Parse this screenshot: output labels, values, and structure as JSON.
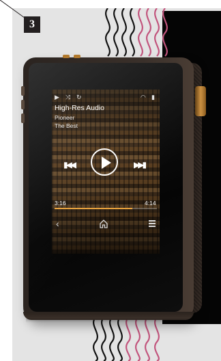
{
  "badge": {
    "number": "3"
  },
  "player": {
    "status_icons": {
      "play": "play-icon",
      "shuffle": "shuffle-icon",
      "repeat": "repeat-icon",
      "wifi": "wifi-icon",
      "battery": "battery-icon"
    },
    "track": {
      "title": "High-Res Audio",
      "artist": "Pioneer",
      "album": "The Best"
    },
    "controls": {
      "prev": "previous-icon",
      "play": "play-icon",
      "next": "next-icon"
    },
    "time": {
      "elapsed": "3:16",
      "total": "4:14"
    },
    "progress": 0.76,
    "nav": {
      "back": "back-icon",
      "home": "home-icon",
      "menu": "menu-icon"
    }
  },
  "colors": {
    "accent": "#e8a23c",
    "wave_pink": "#c2557d",
    "wave_black": "#111111",
    "device_body": "#2b2420",
    "knob_gold": "#e3a24a"
  }
}
